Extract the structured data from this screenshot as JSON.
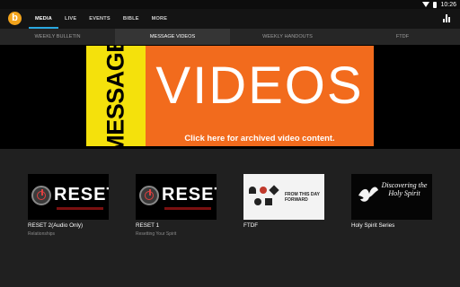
{
  "status_bar": {
    "time": "10:26"
  },
  "app": {
    "logo_letter": "b"
  },
  "nav": {
    "tabs": [
      {
        "label": "MEDIA",
        "active": true
      },
      {
        "label": "LIVE"
      },
      {
        "label": "EVENTS"
      },
      {
        "label": "BIBLE"
      },
      {
        "label": "MORE"
      }
    ]
  },
  "subtabs": [
    {
      "label": "WEEKLY BULLETIN"
    },
    {
      "label": "MESSAGE VIDEOS",
      "active": true
    },
    {
      "label": "WEEKLY HANDOUTS"
    },
    {
      "label": "FTDF"
    }
  ],
  "banner": {
    "vertical_text": "MESSAGE",
    "title": "VIDEOS",
    "link_text": "Click here for archived video content."
  },
  "cards": [
    {
      "title": "RESET 2(Audio Only)",
      "subtitle": "Relationships",
      "thumb_text": "RESET"
    },
    {
      "title": "RESET 1",
      "subtitle": "Resetting Your Spirit",
      "thumb_text": "RESET"
    },
    {
      "title": "FTDF",
      "subtitle": "",
      "thumb_text": "FROM THIS DAY FORWARD"
    },
    {
      "title": "Holy Spirit Series",
      "subtitle": "",
      "thumb_text": "Discovering the Holy Spirit"
    }
  ],
  "colors": {
    "accent": "#29a8e0",
    "banner_orange": "#f26b1d",
    "banner_yellow": "#f4e10c",
    "logo": "#f2a31b"
  }
}
